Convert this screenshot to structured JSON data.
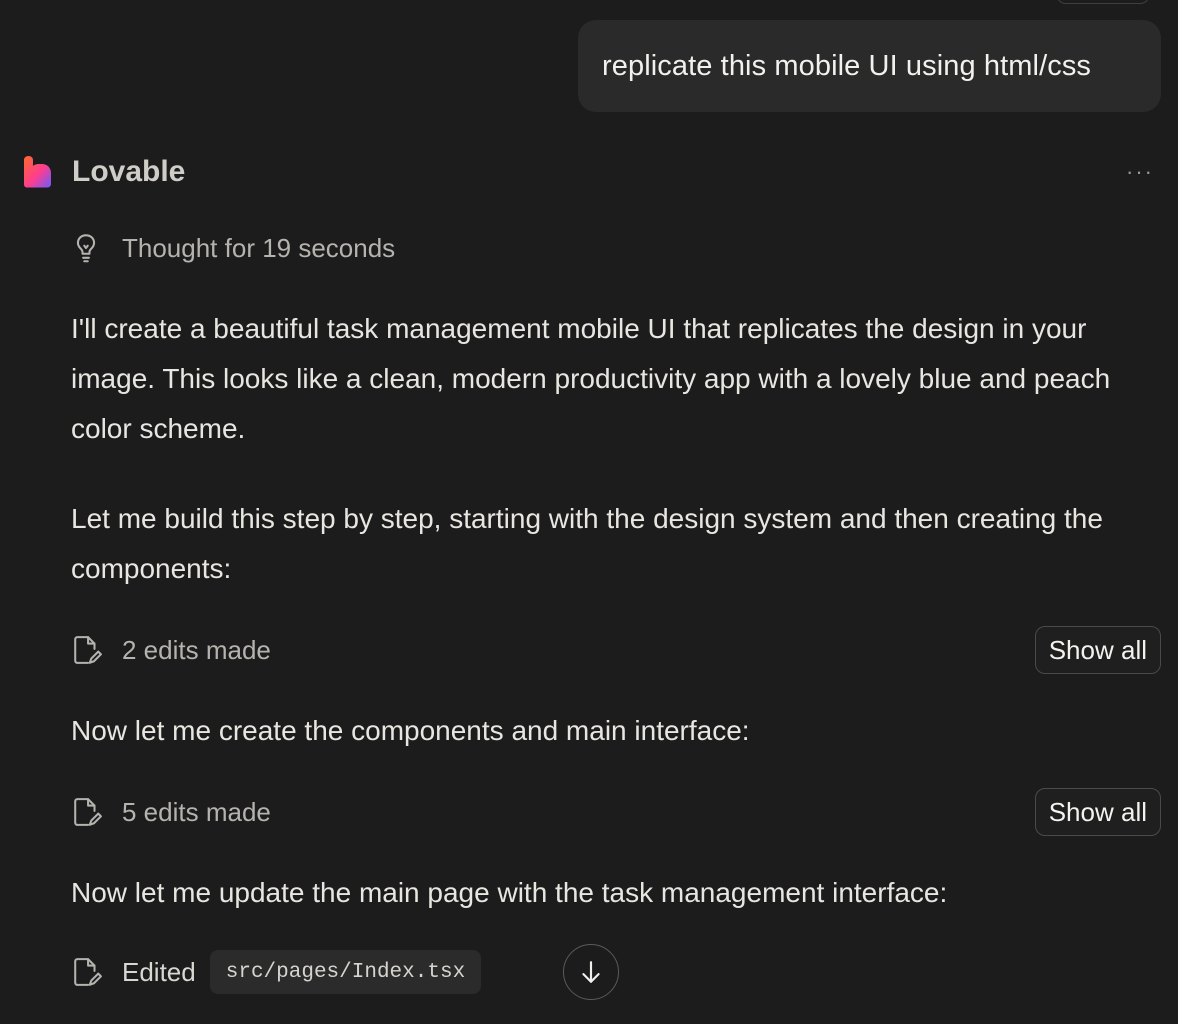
{
  "user_message": "replicate this mobile UI using html/css",
  "assistant": {
    "name": "Lovable",
    "more_icon": "ellipsis-icon"
  },
  "thought": {
    "icon": "lightbulb-icon",
    "text": "Thought for 19 seconds"
  },
  "messages": {
    "p1": "I'll create a beautiful task management mobile UI that replicates the design in your image. This looks like a clean, modern productivity app with a lovely blue and peach color scheme.",
    "p2": "Let me build this step by step, starting with the design system and then creating the components:",
    "p3": "Now let me create the components and main interface:",
    "p4": "Now let me update the main page with the task management interface:"
  },
  "edits": [
    {
      "label": "2 edits made",
      "button": "Show all"
    },
    {
      "label": "5 edits made",
      "button": "Show all"
    }
  ],
  "edited": {
    "label": "Edited",
    "file": "src/pages/Index.tsx"
  },
  "colors": {
    "background": "#1c1c1c",
    "bubble": "#2a2a2a",
    "logo_gradient": [
      "#ff5a3c",
      "#ff3d9a",
      "#6b5bff"
    ]
  }
}
